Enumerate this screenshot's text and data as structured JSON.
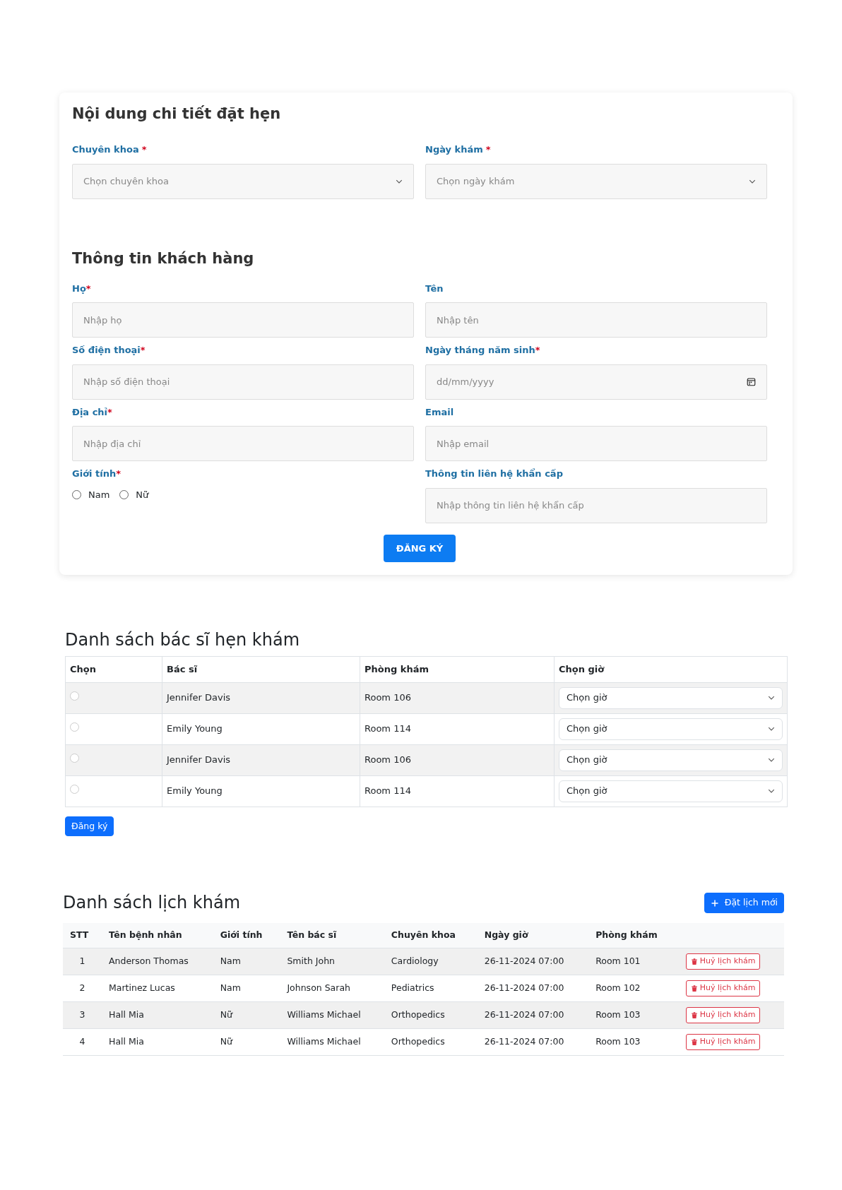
{
  "booking_card": {
    "title": "Nội dung chi tiết đặt hẹn",
    "selects": [
      {
        "label": "Chuyên khoa",
        "mark": "*",
        "placeholder": "Chọn chuyên khoa"
      },
      {
        "label": "Ngày khám",
        "mark": "*",
        "placeholder": "Chọn ngày khám"
      }
    ],
    "customer_title": "Thông tin khách hàng",
    "fields": [
      {
        "kind": "text",
        "label": "Họ",
        "mark": "*",
        "placeholder": "Nhập họ"
      },
      {
        "kind": "text",
        "label": "Tên",
        "placeholder": "Nhập tên"
      },
      {
        "kind": "text",
        "label": "Số điện thoại",
        "mark": "*",
        "placeholder": "Nhập số điện thoại"
      },
      {
        "kind": "date",
        "label": "Ngày tháng năm sinh",
        "mark": "*",
        "placeholder": "dd/mm/yyyy"
      },
      {
        "kind": "text",
        "label": "Địa chỉ",
        "mark": "*",
        "placeholder": "Nhập địa chỉ"
      },
      {
        "kind": "text",
        "label": "Email",
        "placeholder": "Nhập email"
      },
      {
        "kind": "radio",
        "label": "Giới tính",
        "mark": "*",
        "options": [
          {
            "label": "Nam",
            "selected": false
          },
          {
            "label": "Nữ",
            "selected": false
          }
        ]
      },
      {
        "kind": "text",
        "label": "Thông tin liên hệ khẩn cấp",
        "placeholder": "Nhập thông tin liên hệ khẩn cấp"
      }
    ],
    "submit": "ĐĂNG KÝ"
  },
  "doctors": {
    "title": "Danh sách bác sĩ hẹn khám",
    "columns": [
      "Chọn",
      "Bác sĩ",
      "Phòng khám",
      "Chọn giờ"
    ],
    "rows": [
      {
        "selected": false,
        "doctor": "Jennifer Davis",
        "room": "Room 106",
        "time": "Chọn giờ"
      },
      {
        "selected": false,
        "doctor": "Emily Young",
        "room": "Room 114",
        "time": "Chọn giờ"
      },
      {
        "selected": false,
        "doctor": "Jennifer Davis",
        "room": "Room 106",
        "time": "Chọn giờ"
      },
      {
        "selected": false,
        "doctor": "Emily Young",
        "room": "Room 114",
        "time": "Chọn giờ"
      }
    ],
    "submit": "Đăng ký"
  },
  "appointments": {
    "title": "Danh sách lịch khám",
    "new_button": "Đặt lịch mới",
    "columns": [
      "STT",
      "Tên bệnh nhân",
      "Giới tính",
      "Tên bác sĩ",
      "Chuyên khoa",
      "Ngày giờ",
      "Phòng khám"
    ],
    "rows": [
      {
        "cells": [
          "1",
          "Anderson Thomas",
          "Nam",
          "Smith John",
          "Cardiology",
          "26-11-2024 07:00",
          "Room 101"
        ],
        "action": "Huỷ lịch khám"
      },
      {
        "cells": [
          "2",
          "Martinez Lucas",
          "Nam",
          "Johnson Sarah",
          "Pediatrics",
          "26-11-2024 07:00",
          "Room 102"
        ],
        "action": "Huỷ lịch khám"
      },
      {
        "cells": [
          "3",
          "Hall Mia",
          "Nữ",
          "Williams Michael",
          "Orthopedics",
          "26-11-2024 07:00",
          "Room 103"
        ],
        "action": "Huỷ lịch khám"
      },
      {
        "cells": [
          "4",
          "Hall Mia",
          "Nữ",
          "Williams Michael",
          "Orthopedics",
          "26-11-2024 07:00",
          "Room 103"
        ],
        "action": "Huỷ lịch khám"
      }
    ]
  }
}
